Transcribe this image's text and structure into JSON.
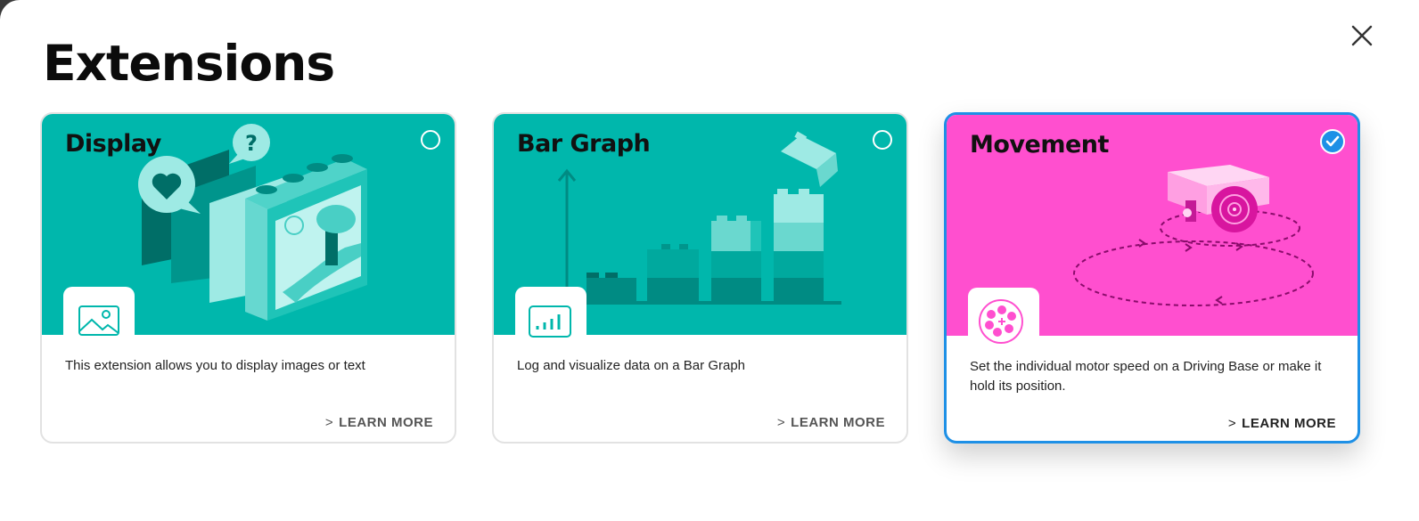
{
  "dialog": {
    "title": "Extensions",
    "close_icon": "close-icon"
  },
  "colors": {
    "teal": "#00b7ac",
    "magenta": "#ff4fcf",
    "accent": "#1e90e6"
  },
  "cards": [
    {
      "name": "Display",
      "description": "This extension allows you to display images or text",
      "learn_more": "LEARN MORE",
      "icon": "image-icon",
      "selected": false
    },
    {
      "name": "Bar Graph",
      "description": "Log and visualize data on a Bar Graph",
      "learn_more": "LEARN MORE",
      "icon": "bar-chart-icon",
      "selected": false
    },
    {
      "name": "Movement",
      "description": "Set the individual motor speed on a Driving Base or make it hold its position.",
      "learn_more": "LEARN MORE",
      "icon": "motor-icon",
      "selected": true
    }
  ]
}
